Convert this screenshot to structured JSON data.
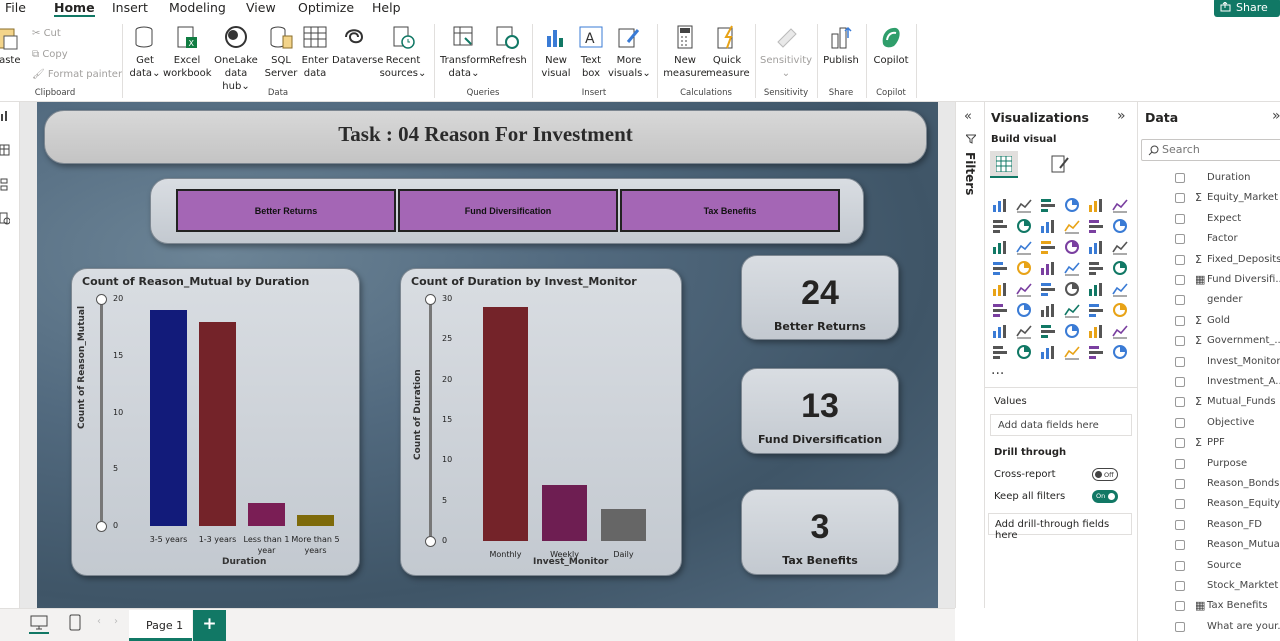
{
  "menu": [
    "File",
    "Home",
    "Insert",
    "Modeling",
    "View",
    "Optimize",
    "Help"
  ],
  "share_label": "Share",
  "ribbon": {
    "paste": "Paste",
    "cut": "Cut",
    "copy": "Copy",
    "format_painter": "Format painter",
    "get_data": [
      "Get",
      "data"
    ],
    "excel": [
      "Excel",
      "workbook"
    ],
    "onelake": [
      "OneLake",
      "data hub"
    ],
    "sql": [
      "SQL",
      "Server"
    ],
    "enter": [
      "Enter",
      "data"
    ],
    "dataverse": "Dataverse",
    "recent": [
      "Recent",
      "sources"
    ],
    "transform": [
      "Transform",
      "data"
    ],
    "refresh": "Refresh",
    "new_visual": [
      "New",
      "visual"
    ],
    "text_box": [
      "Text",
      "box"
    ],
    "more_visuals": [
      "More",
      "visuals"
    ],
    "new_measure": [
      "New",
      "measure"
    ],
    "quick_measure": [
      "Quick",
      "measure"
    ],
    "sensitivity": "Sensitivity",
    "publish": "Publish",
    "copilot": "Copilot",
    "groups": [
      "Clipboard",
      "Data",
      "Queries",
      "Insert",
      "Calculations",
      "Sensitivity",
      "Share",
      "Copilot"
    ]
  },
  "report": {
    "title": "Task : 04 Reason For Investment",
    "buttons": [
      "Better Returns",
      "Fund Diversification",
      "Tax Benefits"
    ],
    "cards": [
      {
        "value": "24",
        "label": "Better Returns"
      },
      {
        "value": "13",
        "label": "Fund Diversification"
      },
      {
        "value": "3",
        "label": "Tax Benefits"
      }
    ]
  },
  "chart_data": [
    {
      "type": "bar",
      "title": "Count of Reason_Mutual by Duration",
      "xlabel": "Duration",
      "ylabel": "Count of Reason_Mutual",
      "categories": [
        "3-5 years",
        "1-3 years",
        "Less than 1 year",
        "More than 5 years"
      ],
      "values": [
        19,
        18,
        2,
        1
      ],
      "ylim": [
        0,
        20
      ],
      "yticks": [
        "20",
        "15",
        "10",
        "5",
        "0"
      ],
      "colors": [
        "#121b7a",
        "#742329",
        "#7a1e55",
        "#7e6a0a"
      ]
    },
    {
      "type": "bar",
      "title": "Count of Duration by Invest_Monitor",
      "xlabel": "Invest_Monitor",
      "ylabel": "Count of Duration",
      "categories": [
        "Monthly",
        "Weekly",
        "Daily"
      ],
      "values": [
        29,
        7,
        4
      ],
      "ylim": [
        0,
        30
      ],
      "yticks": [
        "30",
        "25",
        "20",
        "15",
        "10",
        "5",
        "0"
      ],
      "colors": [
        "#742329",
        "#6e1e52",
        "#666666"
      ]
    }
  ],
  "filters_label": "Filters",
  "viz": {
    "title": "Visualizations",
    "build": "Build visual",
    "values": "Values",
    "values_ph": "Add data fields here",
    "drill": "Drill through",
    "cross": "Cross-report",
    "cross_state": "Off",
    "keep": "Keep all filters",
    "keep_state": "On",
    "drill_ph": "Add drill-through fields here",
    "more": "..."
  },
  "data": {
    "title": "Data",
    "search_ph": "Search",
    "fields": [
      {
        "name": "Duration",
        "sigma": false
      },
      {
        "name": "Equity_Market",
        "sigma": true
      },
      {
        "name": "Expect",
        "sigma": false
      },
      {
        "name": "Factor",
        "sigma": false
      },
      {
        "name": "Fixed_Deposits",
        "sigma": true
      },
      {
        "name": "Fund Diversifi...",
        "sigma": false,
        "table": true
      },
      {
        "name": "gender",
        "sigma": false
      },
      {
        "name": "Gold",
        "sigma": true
      },
      {
        "name": "Government_...",
        "sigma": true
      },
      {
        "name": "Invest_Monitor",
        "sigma": false
      },
      {
        "name": "Investment_A...",
        "sigma": false
      },
      {
        "name": "Mutual_Funds",
        "sigma": true
      },
      {
        "name": "Objective",
        "sigma": false
      },
      {
        "name": "PPF",
        "sigma": true
      },
      {
        "name": "Purpose",
        "sigma": false
      },
      {
        "name": "Reason_Bonds",
        "sigma": false
      },
      {
        "name": "Reason_Equity",
        "sigma": false
      },
      {
        "name": "Reason_FD",
        "sigma": false
      },
      {
        "name": "Reason_Mutual",
        "sigma": false
      },
      {
        "name": "Source",
        "sigma": false
      },
      {
        "name": "Stock_Marktet",
        "sigma": false
      },
      {
        "name": "Tax Benefits",
        "sigma": false,
        "table": true
      },
      {
        "name": "What are your...",
        "sigma": false
      }
    ]
  },
  "pages": {
    "tab": "Page 1",
    "add": "+"
  }
}
